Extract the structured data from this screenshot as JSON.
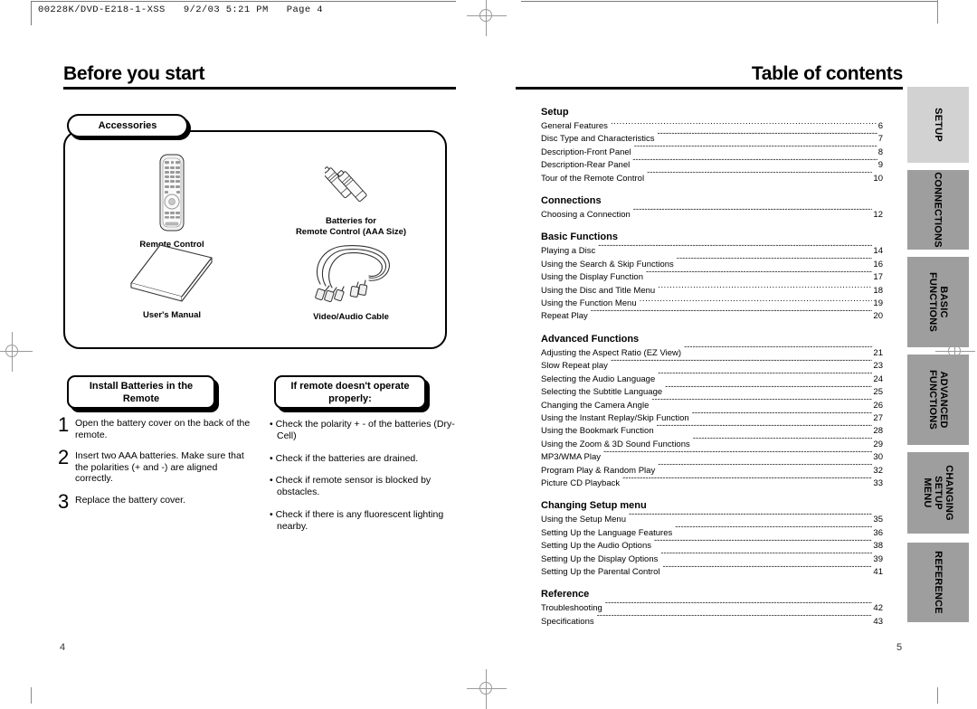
{
  "plate": {
    "slug": "00228K/DVD-E218-1-XSS   9/2/03 5:21 PM   Page 4"
  },
  "left_page": {
    "heading": "Before you start",
    "folio": "4",
    "accessories": {
      "tab_label": "Accessories",
      "items": [
        {
          "icon": "remote-control-icon",
          "caption": "Remote Control"
        },
        {
          "icon": "batteries-icon",
          "caption": "Batteries for\nRemote Control (AAA Size)"
        },
        {
          "icon": "users-manual-icon",
          "caption": "User's Manual"
        },
        {
          "icon": "av-cable-icon",
          "caption": "Video/Audio Cable"
        }
      ]
    },
    "install_batteries": {
      "callout": "Install Batteries in the\nRemote",
      "steps": [
        {
          "num": "1",
          "text": "Open the battery cover on the back of the remote."
        },
        {
          "num": "2",
          "text": "Insert two AAA batteries. Make sure that the polarities (+ and -) are aligned correctly."
        },
        {
          "num": "3",
          "text": "Replace the battery cover."
        }
      ]
    },
    "remote_troubleshoot": {
      "callout": "If remote doesn't operate\nproperly:",
      "bullets": [
        "• Check the polarity + - of the batteries (Dry-Cell)",
        "• Check if the batteries are drained.",
        "• Check if remote sensor is blocked by obstacles.",
        "• Check if there is any fluorescent lighting nearby."
      ]
    }
  },
  "right_page": {
    "heading": "Table of contents",
    "folio": "5",
    "toc": [
      {
        "title": "Setup",
        "entries": [
          {
            "label": "General Features",
            "page": "6",
            "leader": "dot"
          },
          {
            "label": "Disc Type and Characteristics",
            "page": "7",
            "leader": "dash"
          },
          {
            "label": "Description-Front Panel",
            "page": "8",
            "leader": "dash"
          },
          {
            "label": "Description-Rear Panel",
            "page": "9",
            "leader": "dash"
          },
          {
            "label": "Tour of the Remote Control",
            "page": "10",
            "leader": "dash"
          }
        ]
      },
      {
        "title": "Connections",
        "entries": [
          {
            "label": "Choosing a Connection",
            "page": "12",
            "leader": "dash"
          }
        ]
      },
      {
        "title": "Basic Functions",
        "entries": [
          {
            "label": "Playing a Disc",
            "page": "14",
            "leader": "dash"
          },
          {
            "label": "Using the Search & Skip Functions",
            "page": "16",
            "leader": "dash"
          },
          {
            "label": "Using the Display Function",
            "page": "17",
            "leader": "dash"
          },
          {
            "label": "Using the Disc and Title Menu",
            "page": "18",
            "leader": "dot"
          },
          {
            "label": "Using the Function Menu",
            "page": "19",
            "leader": "dot"
          },
          {
            "label": "Repeat Play",
            "page": "20",
            "leader": "dash"
          }
        ]
      },
      {
        "title": "Advanced Functions",
        "entries": [
          {
            "label": "Adjusting the Aspect Ratio (EZ View)",
            "page": "21",
            "leader": "dash"
          },
          {
            "label": "Slow Repeat play",
            "page": "23",
            "leader": "dash"
          },
          {
            "label": "Selecting the Audio Language",
            "page": "24",
            "leader": "dash"
          },
          {
            "label": "Selecting the Subtitle Language",
            "page": "25",
            "leader": "dash"
          },
          {
            "label": "Changing the Camera Angle",
            "page": "26",
            "leader": "dash"
          },
          {
            "label": "Using the Instant Replay/Skip Function",
            "page": "27",
            "leader": "dash"
          },
          {
            "label": "Using the Bookmark Function",
            "page": "28",
            "leader": "dash"
          },
          {
            "label": "Using the Zoom & 3D Sound Functions",
            "page": "29",
            "leader": "dash"
          },
          {
            "label": "MP3/WMA Play",
            "page": "30",
            "leader": "dash"
          },
          {
            "label": "Program Play & Random Play",
            "page": "32",
            "leader": "dash"
          },
          {
            "label": "Picture CD Playback",
            "page": "33",
            "leader": "dash"
          }
        ]
      },
      {
        "title": "Changing Setup menu",
        "entries": [
          {
            "label": "Using the Setup Menu",
            "page": "35",
            "leader": "dash"
          },
          {
            "label": "Setting Up the Language Features",
            "page": "36",
            "leader": "dash"
          },
          {
            "label": "Setting Up the Audio Options",
            "page": "38",
            "leader": "dash"
          },
          {
            "label": "Setting Up the Display Options",
            "page": "39",
            "leader": "dash"
          },
          {
            "label": "Setting Up the Parental Control",
            "page": "41",
            "leader": "dash"
          }
        ]
      },
      {
        "title": "Reference",
        "entries": [
          {
            "label": "Troubleshooting",
            "page": "42",
            "leader": "dash"
          },
          {
            "label": "Specifications",
            "page": "43",
            "leader": "dash"
          }
        ]
      }
    ]
  },
  "side_tabs": [
    {
      "label": "SETUP",
      "color": "#d2d2d2"
    },
    {
      "label": "CONNECTIONS",
      "color": "#9e9e9e"
    },
    {
      "label": "BASIC\nFUNCTIONS",
      "color": "#9e9e9e"
    },
    {
      "label": "ADVANCED\nFUNCTIONS",
      "color": "#9e9e9e"
    },
    {
      "label": "CHANGING\nSETUP MENU",
      "color": "#9e9e9e"
    },
    {
      "label": "REFERENCE",
      "color": "#9e9e9e"
    }
  ]
}
